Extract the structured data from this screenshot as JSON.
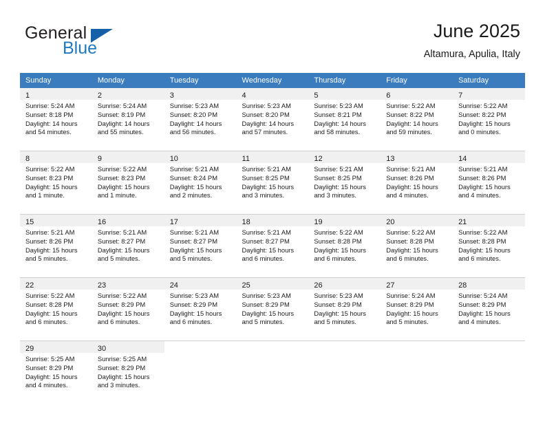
{
  "brand": {
    "name_part1": "General",
    "name_part2": "Blue",
    "flag_icon": "triangle-flag-icon"
  },
  "header": {
    "title": "June 2025",
    "subtitle": "Altamura, Apulia, Italy"
  },
  "colors": {
    "header_blue": "#3a7cbe",
    "brand_blue": "#1f79c0",
    "daynum_band": "#f0f0f0",
    "row_divider": "#cfcfcf"
  },
  "weekday_headers": [
    "Sunday",
    "Monday",
    "Tuesday",
    "Wednesday",
    "Thursday",
    "Friday",
    "Saturday"
  ],
  "weeks": [
    [
      {
        "day": "1",
        "sunrise": "Sunrise: 5:24 AM",
        "sunset": "Sunset: 8:18 PM",
        "daylight1": "Daylight: 14 hours",
        "daylight2": "and 54 minutes."
      },
      {
        "day": "2",
        "sunrise": "Sunrise: 5:24 AM",
        "sunset": "Sunset: 8:19 PM",
        "daylight1": "Daylight: 14 hours",
        "daylight2": "and 55 minutes."
      },
      {
        "day": "3",
        "sunrise": "Sunrise: 5:23 AM",
        "sunset": "Sunset: 8:20 PM",
        "daylight1": "Daylight: 14 hours",
        "daylight2": "and 56 minutes."
      },
      {
        "day": "4",
        "sunrise": "Sunrise: 5:23 AM",
        "sunset": "Sunset: 8:20 PM",
        "daylight1": "Daylight: 14 hours",
        "daylight2": "and 57 minutes."
      },
      {
        "day": "5",
        "sunrise": "Sunrise: 5:23 AM",
        "sunset": "Sunset: 8:21 PM",
        "daylight1": "Daylight: 14 hours",
        "daylight2": "and 58 minutes."
      },
      {
        "day": "6",
        "sunrise": "Sunrise: 5:22 AM",
        "sunset": "Sunset: 8:22 PM",
        "daylight1": "Daylight: 14 hours",
        "daylight2": "and 59 minutes."
      },
      {
        "day": "7",
        "sunrise": "Sunrise: 5:22 AM",
        "sunset": "Sunset: 8:22 PM",
        "daylight1": "Daylight: 15 hours",
        "daylight2": "and 0 minutes."
      }
    ],
    [
      {
        "day": "8",
        "sunrise": "Sunrise: 5:22 AM",
        "sunset": "Sunset: 8:23 PM",
        "daylight1": "Daylight: 15 hours",
        "daylight2": "and 1 minute."
      },
      {
        "day": "9",
        "sunrise": "Sunrise: 5:22 AM",
        "sunset": "Sunset: 8:23 PM",
        "daylight1": "Daylight: 15 hours",
        "daylight2": "and 1 minute."
      },
      {
        "day": "10",
        "sunrise": "Sunrise: 5:21 AM",
        "sunset": "Sunset: 8:24 PM",
        "daylight1": "Daylight: 15 hours",
        "daylight2": "and 2 minutes."
      },
      {
        "day": "11",
        "sunrise": "Sunrise: 5:21 AM",
        "sunset": "Sunset: 8:25 PM",
        "daylight1": "Daylight: 15 hours",
        "daylight2": "and 3 minutes."
      },
      {
        "day": "12",
        "sunrise": "Sunrise: 5:21 AM",
        "sunset": "Sunset: 8:25 PM",
        "daylight1": "Daylight: 15 hours",
        "daylight2": "and 3 minutes."
      },
      {
        "day": "13",
        "sunrise": "Sunrise: 5:21 AM",
        "sunset": "Sunset: 8:26 PM",
        "daylight1": "Daylight: 15 hours",
        "daylight2": "and 4 minutes."
      },
      {
        "day": "14",
        "sunrise": "Sunrise: 5:21 AM",
        "sunset": "Sunset: 8:26 PM",
        "daylight1": "Daylight: 15 hours",
        "daylight2": "and 4 minutes."
      }
    ],
    [
      {
        "day": "15",
        "sunrise": "Sunrise: 5:21 AM",
        "sunset": "Sunset: 8:26 PM",
        "daylight1": "Daylight: 15 hours",
        "daylight2": "and 5 minutes."
      },
      {
        "day": "16",
        "sunrise": "Sunrise: 5:21 AM",
        "sunset": "Sunset: 8:27 PM",
        "daylight1": "Daylight: 15 hours",
        "daylight2": "and 5 minutes."
      },
      {
        "day": "17",
        "sunrise": "Sunrise: 5:21 AM",
        "sunset": "Sunset: 8:27 PM",
        "daylight1": "Daylight: 15 hours",
        "daylight2": "and 5 minutes."
      },
      {
        "day": "18",
        "sunrise": "Sunrise: 5:21 AM",
        "sunset": "Sunset: 8:27 PM",
        "daylight1": "Daylight: 15 hours",
        "daylight2": "and 6 minutes."
      },
      {
        "day": "19",
        "sunrise": "Sunrise: 5:22 AM",
        "sunset": "Sunset: 8:28 PM",
        "daylight1": "Daylight: 15 hours",
        "daylight2": "and 6 minutes."
      },
      {
        "day": "20",
        "sunrise": "Sunrise: 5:22 AM",
        "sunset": "Sunset: 8:28 PM",
        "daylight1": "Daylight: 15 hours",
        "daylight2": "and 6 minutes."
      },
      {
        "day": "21",
        "sunrise": "Sunrise: 5:22 AM",
        "sunset": "Sunset: 8:28 PM",
        "daylight1": "Daylight: 15 hours",
        "daylight2": "and 6 minutes."
      }
    ],
    [
      {
        "day": "22",
        "sunrise": "Sunrise: 5:22 AM",
        "sunset": "Sunset: 8:28 PM",
        "daylight1": "Daylight: 15 hours",
        "daylight2": "and 6 minutes."
      },
      {
        "day": "23",
        "sunrise": "Sunrise: 5:22 AM",
        "sunset": "Sunset: 8:29 PM",
        "daylight1": "Daylight: 15 hours",
        "daylight2": "and 6 minutes."
      },
      {
        "day": "24",
        "sunrise": "Sunrise: 5:23 AM",
        "sunset": "Sunset: 8:29 PM",
        "daylight1": "Daylight: 15 hours",
        "daylight2": "and 6 minutes."
      },
      {
        "day": "25",
        "sunrise": "Sunrise: 5:23 AM",
        "sunset": "Sunset: 8:29 PM",
        "daylight1": "Daylight: 15 hours",
        "daylight2": "and 5 minutes."
      },
      {
        "day": "26",
        "sunrise": "Sunrise: 5:23 AM",
        "sunset": "Sunset: 8:29 PM",
        "daylight1": "Daylight: 15 hours",
        "daylight2": "and 5 minutes."
      },
      {
        "day": "27",
        "sunrise": "Sunrise: 5:24 AM",
        "sunset": "Sunset: 8:29 PM",
        "daylight1": "Daylight: 15 hours",
        "daylight2": "and 5 minutes."
      },
      {
        "day": "28",
        "sunrise": "Sunrise: 5:24 AM",
        "sunset": "Sunset: 8:29 PM",
        "daylight1": "Daylight: 15 hours",
        "daylight2": "and 4 minutes."
      }
    ],
    [
      {
        "day": "29",
        "sunrise": "Sunrise: 5:25 AM",
        "sunset": "Sunset: 8:29 PM",
        "daylight1": "Daylight: 15 hours",
        "daylight2": "and 4 minutes."
      },
      {
        "day": "30",
        "sunrise": "Sunrise: 5:25 AM",
        "sunset": "Sunset: 8:29 PM",
        "daylight1": "Daylight: 15 hours",
        "daylight2": "and 3 minutes."
      },
      {
        "day": "",
        "sunrise": "",
        "sunset": "",
        "daylight1": "",
        "daylight2": ""
      },
      {
        "day": "",
        "sunrise": "",
        "sunset": "",
        "daylight1": "",
        "daylight2": ""
      },
      {
        "day": "",
        "sunrise": "",
        "sunset": "",
        "daylight1": "",
        "daylight2": ""
      },
      {
        "day": "",
        "sunrise": "",
        "sunset": "",
        "daylight1": "",
        "daylight2": ""
      },
      {
        "day": "",
        "sunrise": "",
        "sunset": "",
        "daylight1": "",
        "daylight2": ""
      }
    ]
  ]
}
